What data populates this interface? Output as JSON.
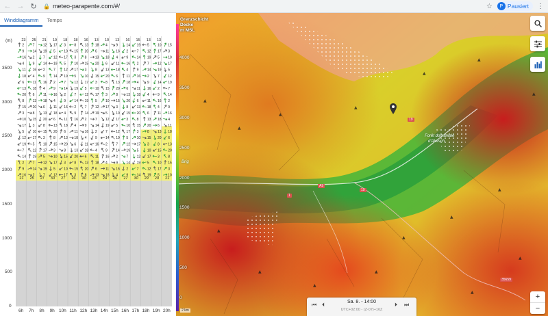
{
  "browser": {
    "url": "meteo-parapente.com/#/",
    "profile_label": "Pausiert",
    "profile_initial": "P"
  },
  "tabs": [
    {
      "label": "Winddiagramm",
      "active": true
    },
    {
      "label": "Temps",
      "active": false
    }
  ],
  "wind_chart": {
    "y_unit": "(m)",
    "y_ticks": [
      "3500",
      "3000",
      "2500",
      "2000",
      "1500",
      "1000",
      "500",
      "0"
    ],
    "hours": [
      "6h",
      "7h",
      "8h",
      "9h",
      "10h",
      "11h",
      "12h",
      "13h",
      "14h",
      "15h",
      "16h",
      "17h",
      "18h",
      "19h",
      "20h"
    ],
    "top_row": [
      "23",
      "25",
      "21",
      "19",
      "18",
      "18",
      "16",
      "13",
      "10",
      "13",
      "16",
      "15",
      "13",
      "13",
      ""
    ],
    "bottom_row": [
      "21",
      "25",
      "27",
      "30",
      "27",
      "26",
      "30",
      "23",
      "24",
      "26",
      "27",
      "30",
      "29",
      "20",
      "21"
    ],
    "colors": {
      "grid_bg": "#d4d4d4",
      "yellow_zone": "#f3f079",
      "arrow_green": "#2e9a3a",
      "arrow_grey": "#555555"
    }
  },
  "map": {
    "legend_title": [
      "Grenzschicht",
      "Decke",
      "m MSL"
    ],
    "legend_ticks": [
      "4000",
      "3500",
      "3000",
      "2500",
      "2000",
      "1500",
      "1000",
      "500",
      "0"
    ],
    "road_labels": [
      "19",
      "A9",
      "1",
      "19",
      "35659"
    ],
    "place_labels": [
      "Forêt domaniale",
      "d'Aletsch",
      "Brig"
    ],
    "time": {
      "main": "Sa. 8. - 14:00",
      "sub": "UTC+02:00 - (Z-07)+16Z"
    },
    "buttons": [
      "search-icon",
      "sliders-icon",
      "bar-chart-icon"
    ],
    "zoom": {
      "in": "+",
      "out": "−"
    },
    "scale": "2 km"
  }
}
